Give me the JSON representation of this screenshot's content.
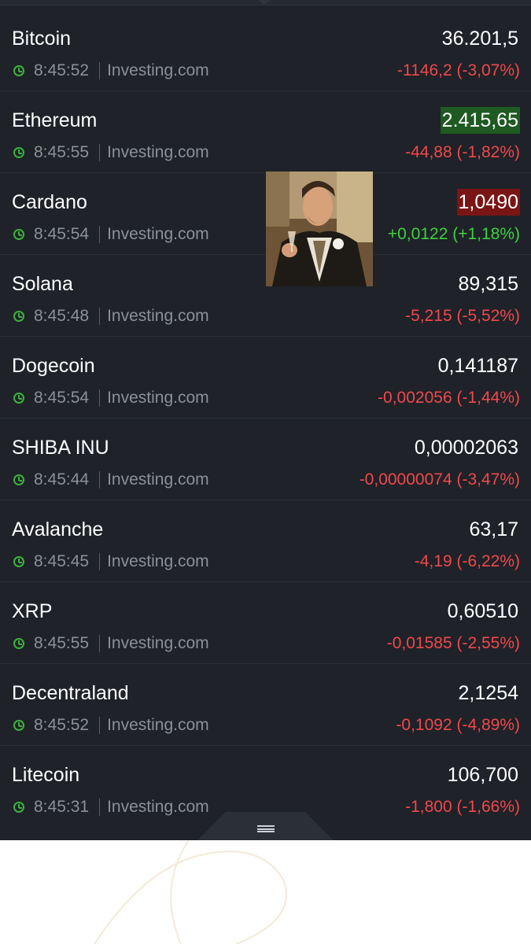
{
  "quotes": [
    {
      "name": "Bitcoin",
      "price": "36.201,5",
      "time": "8:45:52",
      "source": "Investing.com",
      "change": "-1146,2 (-3,07%)",
      "direction": "neg",
      "flash": ""
    },
    {
      "name": "Ethereum",
      "price": "2.415,65",
      "time": "8:45:55",
      "source": "Investing.com",
      "change": "-44,88 (-1,82%)",
      "direction": "neg",
      "flash": "up-flash"
    },
    {
      "name": "Cardano",
      "price": "1,0490",
      "time": "8:45:54",
      "source": "Investing.com",
      "change": "+0,0122 (+1,18%)",
      "direction": "pos",
      "flash": "down-flash"
    },
    {
      "name": "Solana",
      "price": "89,315",
      "time": "8:45:48",
      "source": "Investing.com",
      "change": "-5,215 (-5,52%)",
      "direction": "neg",
      "flash": ""
    },
    {
      "name": "Dogecoin",
      "price": "0,141187",
      "time": "8:45:54",
      "source": "Investing.com",
      "change": "-0,002056 (-1,44%)",
      "direction": "neg",
      "flash": ""
    },
    {
      "name": "SHIBA INU",
      "price": "0,00002063",
      "time": "8:45:44",
      "source": "Investing.com",
      "change": "-0,00000074 (-3,47%)",
      "direction": "neg",
      "flash": ""
    },
    {
      "name": "Avalanche",
      "price": "63,17",
      "time": "8:45:45",
      "source": "Investing.com",
      "change": "-4,19 (-6,22%)",
      "direction": "neg",
      "flash": ""
    },
    {
      "name": "XRP",
      "price": "0,60510",
      "time": "8:45:55",
      "source": "Investing.com",
      "change": "-0,01585 (-2,55%)",
      "direction": "neg",
      "flash": ""
    },
    {
      "name": "Decentraland",
      "price": "2,1254",
      "time": "8:45:52",
      "source": "Investing.com",
      "change": "-0,1092 (-4,89%)",
      "direction": "neg",
      "flash": ""
    },
    {
      "name": "Litecoin",
      "price": "106,700",
      "time": "8:45:31",
      "source": "Investing.com",
      "change": "-1,800 (-1,66%)",
      "direction": "neg",
      "flash": ""
    }
  ],
  "colors": {
    "background": "#1f2229",
    "negative": "#f0484a",
    "positive": "#3bd23b",
    "clock": "#3bb33b",
    "flash_up": "#1e5a22",
    "flash_down": "#7a1515"
  },
  "icons": {
    "time": "clock-icon",
    "drawer_handle": "menu-handle-icon"
  }
}
